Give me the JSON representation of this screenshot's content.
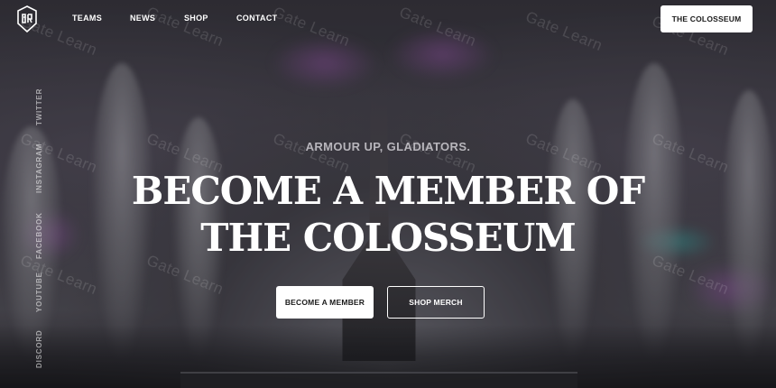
{
  "nav": {
    "items": [
      {
        "label": "TEAMS"
      },
      {
        "label": "NEWS"
      },
      {
        "label": "SHOP"
      },
      {
        "label": "CONTACT"
      }
    ],
    "cta_label": "THE COLOSSEUM"
  },
  "social": {
    "items": [
      {
        "label": "TWITTER"
      },
      {
        "label": "INSTAGRAM"
      },
      {
        "label": "FACEBOOK"
      },
      {
        "label": "YOUTUBE"
      },
      {
        "label": "DISCORD"
      }
    ]
  },
  "hero": {
    "tagline": "ARMOUR UP, GLADIATORS.",
    "headline_line1": "BECOME A MEMBER OF",
    "headline_line2": "THE COLOSSEUM",
    "primary_button": "BECOME A MEMBER",
    "secondary_button": "SHOP MERCH"
  },
  "watermark": {
    "text": "Gate Learn"
  },
  "colors": {
    "primary_button_bg": "#ffffff",
    "background": "#2c2a30",
    "text": "#ffffff"
  }
}
